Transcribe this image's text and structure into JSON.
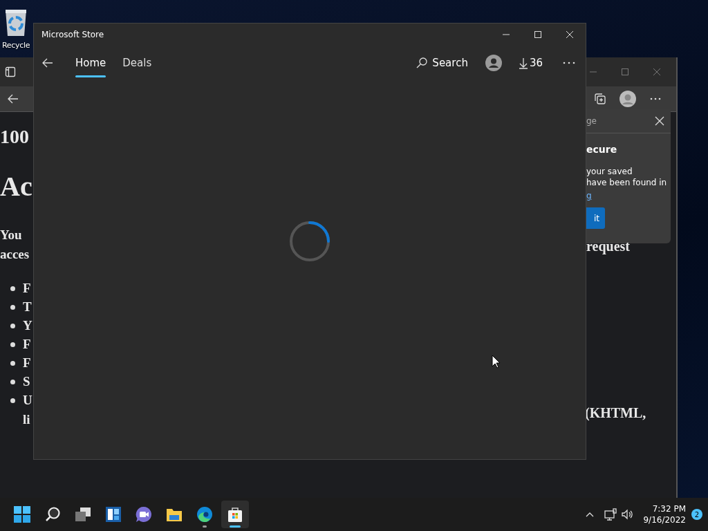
{
  "desktop": {
    "icons": [
      {
        "label": "Recycle"
      }
    ]
  },
  "background_window": {
    "page_left": {
      "heading": "100",
      "title": "Ac",
      "paragraph_lines": [
        "You",
        "acces"
      ],
      "bullets": [
        "F",
        "T",
        "Y",
        "F",
        "F",
        "S",
        "U"
      ],
      "continuation": "li"
    },
    "popup": {
      "title": "ge",
      "heading": "ecure",
      "lines": [
        "your saved",
        "have been found in"
      ],
      "link": "g",
      "button": "it"
    },
    "page_right": {
      "paragraph_end": "request",
      "bullet_end": "(KHTML,"
    }
  },
  "store_window": {
    "title": "Microsoft Store",
    "tabs": [
      {
        "label": "Home",
        "selected": true
      },
      {
        "label": "Deals",
        "selected": false
      }
    ],
    "search": "Search",
    "downloads": "36",
    "loading": true
  },
  "taskbar": {
    "apps": [
      {
        "kind": "start",
        "running": false,
        "selected": false
      },
      {
        "kind": "search",
        "running": false,
        "selected": false
      },
      {
        "kind": "taskview",
        "running": false,
        "selected": false
      },
      {
        "kind": "widgets",
        "running": false,
        "selected": false
      },
      {
        "kind": "chat",
        "running": false,
        "selected": false
      },
      {
        "kind": "folder",
        "running": false,
        "selected": false
      },
      {
        "kind": "browser",
        "running": true,
        "selected": false
      },
      {
        "kind": "store",
        "running": true,
        "selected": true
      }
    ],
    "time": "7:32 PM",
    "date": "9/16/2022",
    "notifications": "2"
  }
}
